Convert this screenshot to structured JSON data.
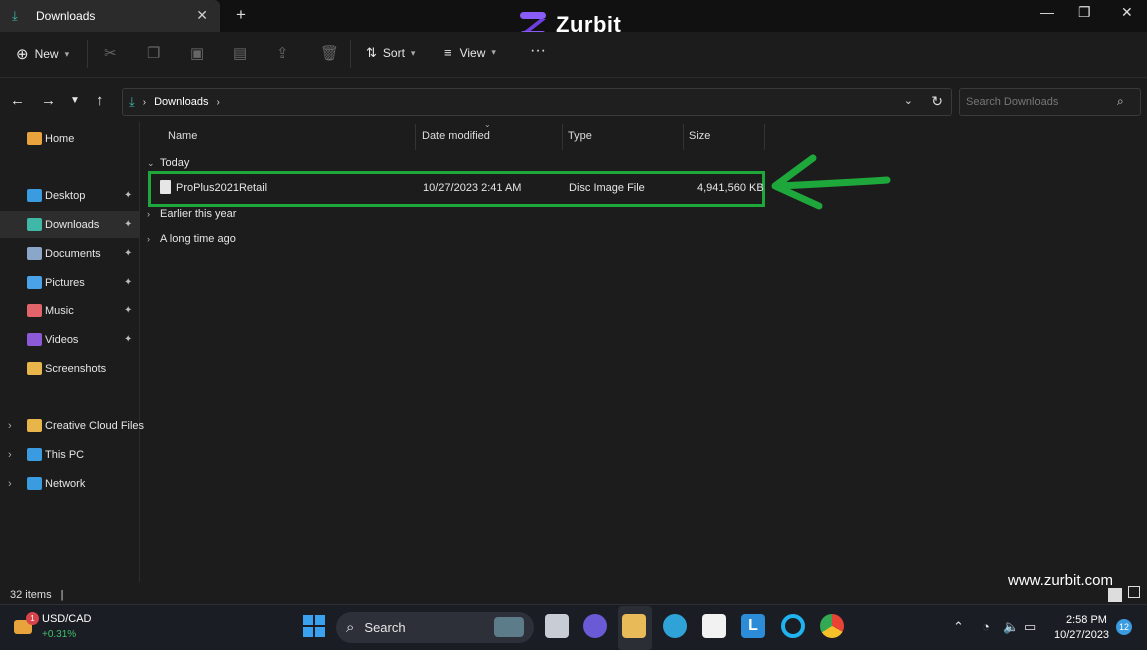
{
  "window": {
    "tab_title": "Downloads",
    "tab_close": "✕",
    "new_tab": "+",
    "brand": "Zurbit",
    "minimize": "—",
    "maximize": "❐",
    "close": "✕"
  },
  "toolbar": {
    "new_label": "New",
    "sort_label": "Sort",
    "view_label": "View",
    "more_label": "···"
  },
  "address": {
    "crumb": "Downloads",
    "search_placeholder": "Search Downloads"
  },
  "sidebar": {
    "items": [
      {
        "label": "Home",
        "icon": "home-icon",
        "color": "#e8a33d"
      },
      {
        "label": "Desktop",
        "icon": "desktop-icon",
        "color": "#3a9be0",
        "pinned": true
      },
      {
        "label": "Downloads",
        "icon": "download-icon",
        "color": "#3fb8a8",
        "pinned": true
      },
      {
        "label": "Documents",
        "icon": "documents-icon",
        "color": "#8aa7c9",
        "pinned": true
      },
      {
        "label": "Pictures",
        "icon": "pictures-icon",
        "color": "#4aa3e8",
        "pinned": true
      },
      {
        "label": "Music",
        "icon": "music-icon",
        "color": "#e0646a",
        "pinned": true
      },
      {
        "label": "Videos",
        "icon": "videos-icon",
        "color": "#8c5ad6",
        "pinned": true
      },
      {
        "label": "Screenshots",
        "icon": "folder-icon",
        "color": "#e8b54a"
      },
      {
        "label": "Creative Cloud Files",
        "icon": "creative-cloud-icon",
        "color": "#e8b54a"
      },
      {
        "label": "This PC",
        "icon": "pc-icon",
        "color": "#3a9be0"
      },
      {
        "label": "Network",
        "icon": "network-icon",
        "color": "#3a9be0"
      }
    ]
  },
  "columns": [
    "Name",
    "Date modified",
    "Type",
    "Size"
  ],
  "groups": {
    "today": "Today",
    "earlier": "Earlier this year",
    "long_ago": "A long time ago"
  },
  "file": {
    "name": "ProPlus2021Retail",
    "date": "10/27/2023 2:41 AM",
    "type": "Disc Image File",
    "size": "4,941,560 KB"
  },
  "status": {
    "items": "32 items"
  },
  "watermark": "www.zurbit.com",
  "taskbar": {
    "ticker_symbol": "USD/CAD",
    "ticker_change": "+0.31%",
    "ticker_badge": "1",
    "search_label": "Search",
    "time": "2:58 PM",
    "date": "10/27/2023",
    "notif_count": "12"
  },
  "colors": {
    "highlight": "#1ea83c",
    "arrow": "#1ea83c",
    "accent": "#3fb8a8"
  }
}
